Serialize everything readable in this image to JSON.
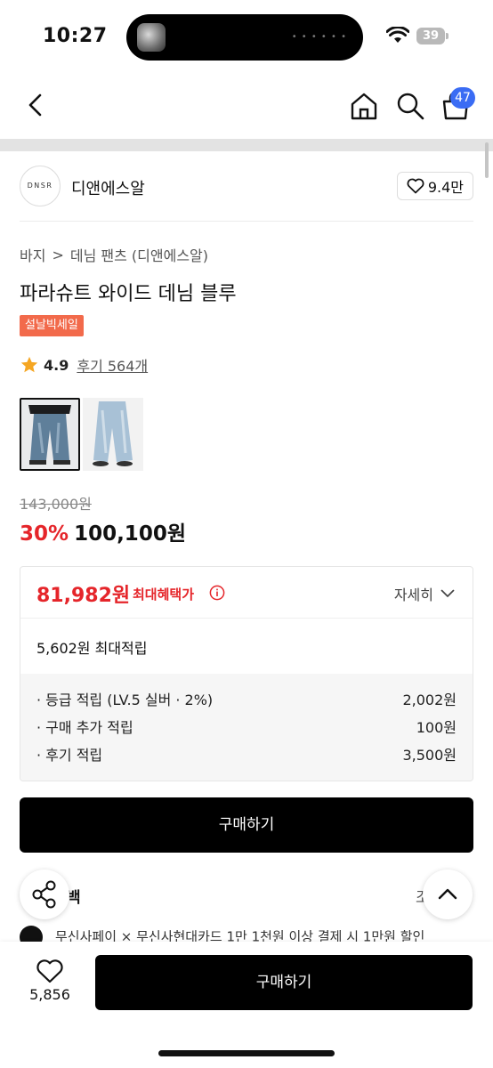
{
  "status_bar": {
    "time": "10:27",
    "battery": "39"
  },
  "nav": {
    "cart_count": "47"
  },
  "brand": {
    "logo_text": "DNSR",
    "name": "디앤에스알",
    "likes": "9.4만"
  },
  "breadcrumb": {
    "category": "바지",
    "separator": ">",
    "subcategory": "데님 팬츠 (디앤에스알)"
  },
  "product": {
    "title": "파라슈트 와이드 데님 블루",
    "badge": "설날빅세일",
    "rating": "4.9",
    "reviews": "후기 564개",
    "original_price": "143,000원",
    "discount": "30%",
    "price": "100,100원"
  },
  "benefit": {
    "best_price": "81,982원",
    "best_label": "최대혜택가",
    "detail_label": "자세히",
    "points_title": "5,602원 최대적립",
    "points": [
      {
        "label": "· 등급 적립 (LV.5 실버 · 2%)",
        "value": "2,002원"
      },
      {
        "label": "· 구매 추가 적립",
        "value": "100원"
      },
      {
        "label": "· 후기 적립",
        "value": "3,500원"
      }
    ]
  },
  "actions": {
    "buy_label": "구매하기"
  },
  "peek": {
    "section_title": "백",
    "section_right": "조",
    "promo_text": "무신사페이 × 무신사현대카드 1만 1천원 이상 결제 시 1만원 할인"
  },
  "bottom_bar": {
    "wish_count": "5,856",
    "buy_label": "구매하기"
  },
  "colors": {
    "sale_red": "#e5252a",
    "badge_orange": "#f26a4b",
    "cart_badge_blue": "#3a6cf4",
    "star": "#f5a623"
  }
}
